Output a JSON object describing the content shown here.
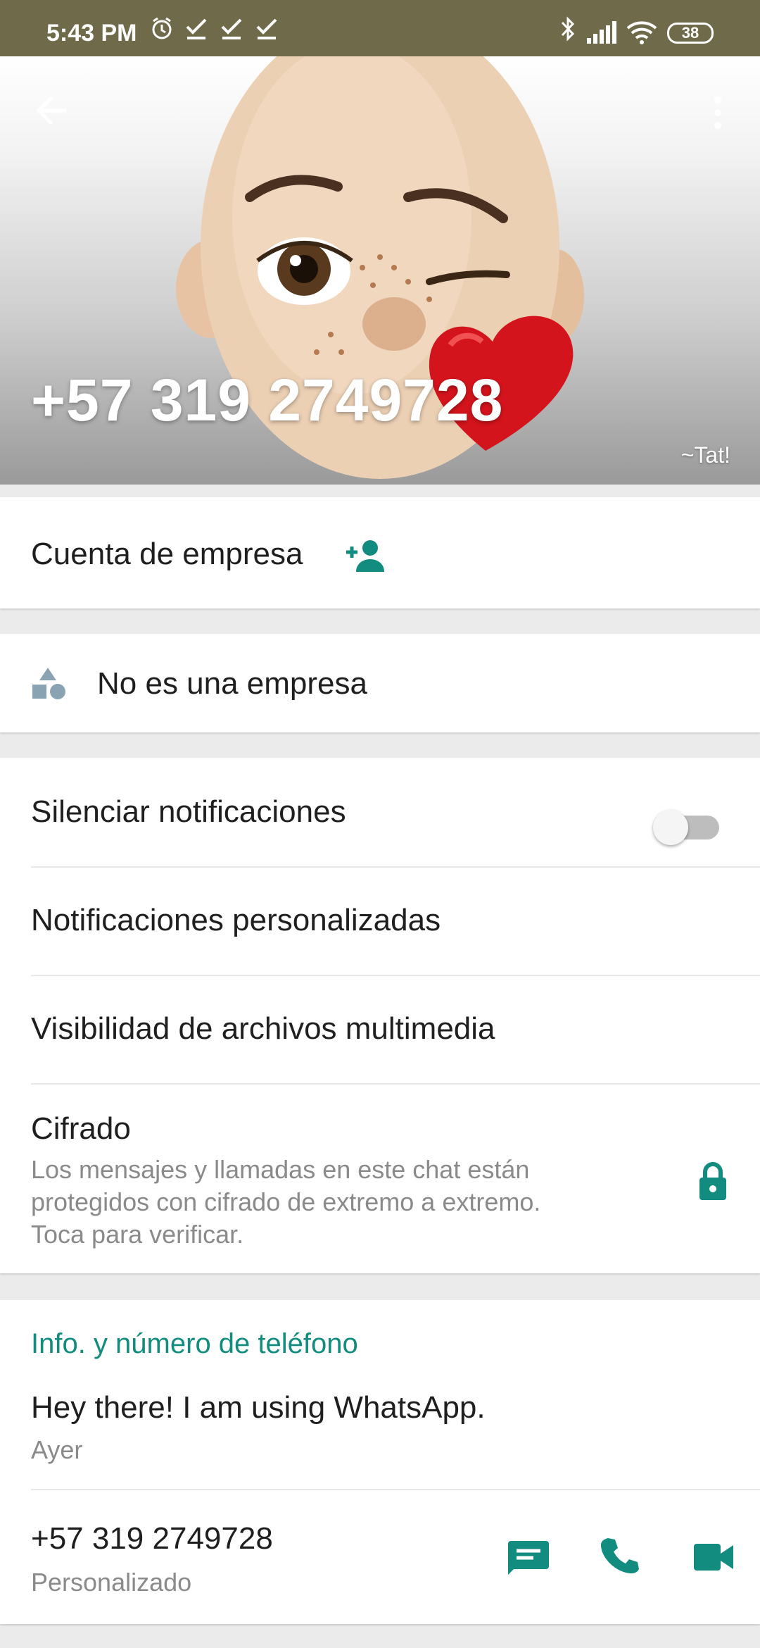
{
  "status_bar": {
    "time": "5:43 PM",
    "battery": "38"
  },
  "profile": {
    "phone_title": "+57 319 2749728",
    "push_name": "~Tat!"
  },
  "business": {
    "label": "Cuenta de empresa",
    "not_business": "No es una empresa"
  },
  "settings": {
    "mute": "Silenciar notificaciones",
    "mute_enabled": false,
    "custom": "Notificaciones personalizadas",
    "media": "Visibilidad de archivos multimedia",
    "encryption_title": "Cifrado",
    "encryption_desc_1": "Los mensajes y llamadas en este chat están",
    "encryption_desc_2": "protegidos con cifrado de extremo a extremo.",
    "encryption_desc_3": "Toca para verificar."
  },
  "about": {
    "section_title": "Info. y número de teléfono",
    "status": "Hey there! I am using WhatsApp.",
    "status_date": "Ayer",
    "phone": "+57 319 2749728",
    "phone_type": "Personalizado"
  },
  "colors": {
    "accent": "#128c7e",
    "statusbar": "#6e6a4a"
  }
}
